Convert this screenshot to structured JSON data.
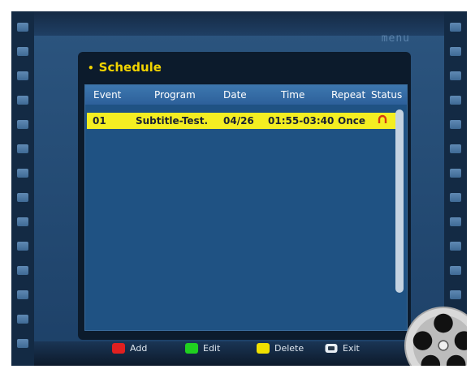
{
  "brand_text": "menu",
  "panel": {
    "title": "Schedule"
  },
  "table": {
    "headers": [
      "Event",
      "Program",
      "Date",
      "Time",
      "Repeat",
      "Status"
    ],
    "rows": [
      {
        "event": "01",
        "program": "Subtitle-Test.",
        "date": "04/26",
        "time": "01:55-03:40",
        "repeat": "Once",
        "status_icon": "alarm-icon"
      }
    ]
  },
  "legend": [
    {
      "label": "Add",
      "color": "#e02020"
    },
    {
      "label": "Edit",
      "color": "#20d020"
    },
    {
      "label": "Delete",
      "color": "#f0e000"
    },
    {
      "label": "Exit",
      "icon": "exit-key-icon"
    }
  ],
  "colors": {
    "highlight": "#f4ee22",
    "title": "#f2d400",
    "list_bg": "#1f5283"
  }
}
